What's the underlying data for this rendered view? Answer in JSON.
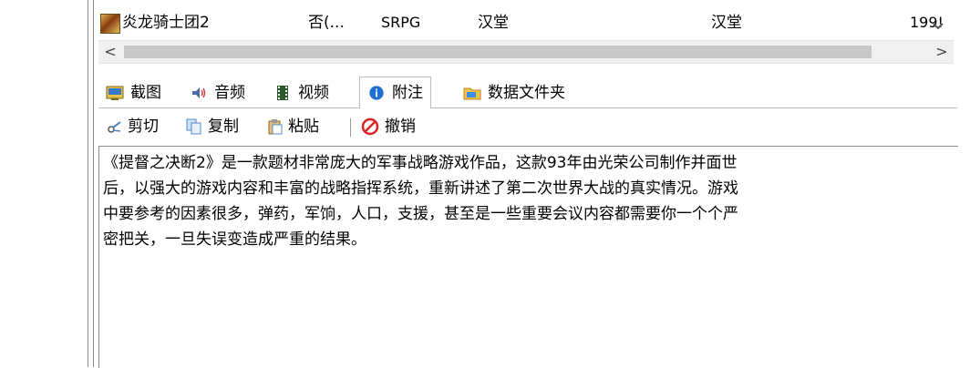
{
  "list_row": {
    "name": "炎龙骑士团2",
    "chinese_flag": "否(...",
    "genre": "SRPG",
    "developer": "汉堂",
    "publisher": "汉堂",
    "year": "199!"
  },
  "scrollbar": {
    "left_arrow": "<",
    "right_arrow": ">"
  },
  "tabs": [
    {
      "label": "截图",
      "icon": "screenshot-icon"
    },
    {
      "label": "音频",
      "icon": "speaker-icon"
    },
    {
      "label": "视频",
      "icon": "film-icon"
    },
    {
      "label": "附注",
      "icon": "info-icon",
      "active": true
    },
    {
      "label": "数据文件夹",
      "icon": "folder-icon"
    }
  ],
  "toolbar": {
    "cut": "剪切",
    "copy": "复制",
    "paste": "粘贴",
    "undo": "撤销"
  },
  "notes": {
    "text": "《提督之决断2》是一款题材非常庞大的军事战略游戏作品，这款93年由光荣公司制作并面世\n后，以强大的游戏内容和丰富的战略指挥系统，重新讲述了第二次世界大战的真实情况。游戏\n中要参考的因素很多，弹药，军饷，人口，支援，甚至是一些重要会议内容都需要你一个个严\n密把关，一旦失误变造成严重的结果。"
  },
  "colors": {
    "undo_red": "#e02020",
    "info_blue": "#1e6fd0",
    "folder_blue": "#3b8fe0",
    "folder_yellow": "#f2c14e"
  }
}
